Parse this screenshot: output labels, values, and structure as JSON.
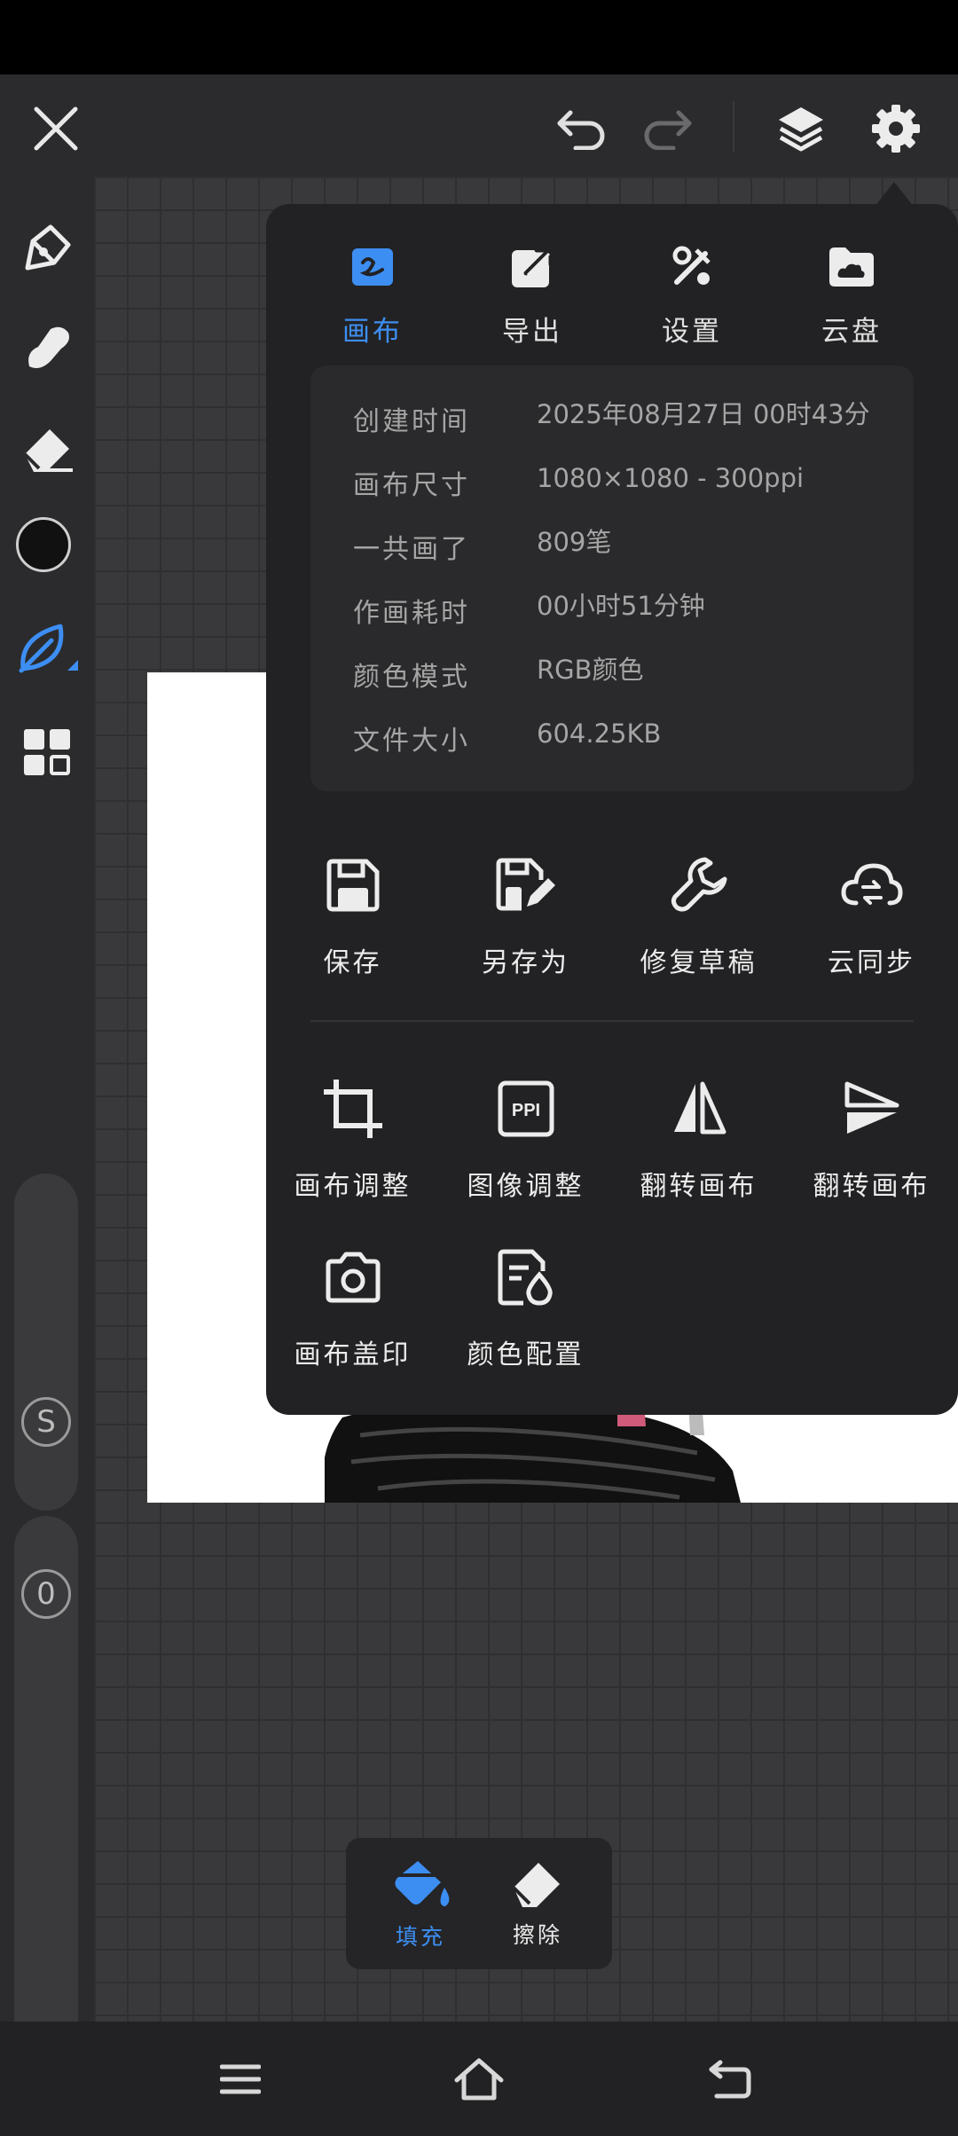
{
  "top_bar": {
    "close_icon": "close-icon",
    "undo_icon": "undo-icon",
    "redo_icon": "redo-icon",
    "layers_icon": "layers-icon",
    "settings_icon": "gear-icon"
  },
  "left_toolbar": {
    "tools": [
      "pen-icon",
      "smudge-icon",
      "eraser-icon",
      "color-swatch",
      "leaf-brush-icon",
      "grid-icon"
    ],
    "size_slider_label": "S",
    "opacity_slider_label": "0"
  },
  "popup": {
    "tabs": [
      {
        "label": "画布",
        "icon": "canvas-icon",
        "active": true
      },
      {
        "label": "导出",
        "icon": "export-icon",
        "active": false
      },
      {
        "label": "设置",
        "icon": "tools-icon",
        "active": false
      },
      {
        "label": "云盘",
        "icon": "cloud-drive-icon",
        "active": false
      }
    ],
    "info": [
      {
        "key": "创建时间",
        "value": "2025年08月27日 00时43分"
      },
      {
        "key": "画布尺寸",
        "value": "1080×1080 - 300ppi"
      },
      {
        "key": "一共画了",
        "value": "809笔"
      },
      {
        "key": "作画耗时",
        "value": "00小时51分钟"
      },
      {
        "key": "颜色模式",
        "value": "RGB颜色"
      },
      {
        "key": "文件大小",
        "value": "604.25KB"
      }
    ],
    "actions_row1": [
      {
        "label": "保存",
        "icon": "save-icon"
      },
      {
        "label": "另存为",
        "icon": "save-as-icon"
      },
      {
        "label": "修复草稿",
        "icon": "wrench-icon"
      },
      {
        "label": "云同步",
        "icon": "cloud-sync-icon"
      }
    ],
    "actions_row2": [
      {
        "label": "画布调整",
        "icon": "crop-icon"
      },
      {
        "label": "图像调整",
        "icon": "ppi-icon",
        "icon_text": "PPI"
      },
      {
        "label": "翻转画布",
        "icon": "flip-horizontal-icon"
      },
      {
        "label": "翻转画布",
        "icon": "flip-vertical-icon"
      }
    ],
    "actions_row3": [
      {
        "label": "画布盖印",
        "icon": "camera-icon"
      },
      {
        "label": "颜色配置",
        "icon": "color-config-icon"
      }
    ]
  },
  "fill_bar": {
    "fill_label": "填充",
    "erase_label": "擦除"
  },
  "colors": {
    "accent": "#3d8ef2",
    "background": "#2b2b2d",
    "popup": "#222224"
  },
  "nav_bar": {
    "icons": [
      "menu-icon",
      "home-icon",
      "back-icon"
    ]
  }
}
